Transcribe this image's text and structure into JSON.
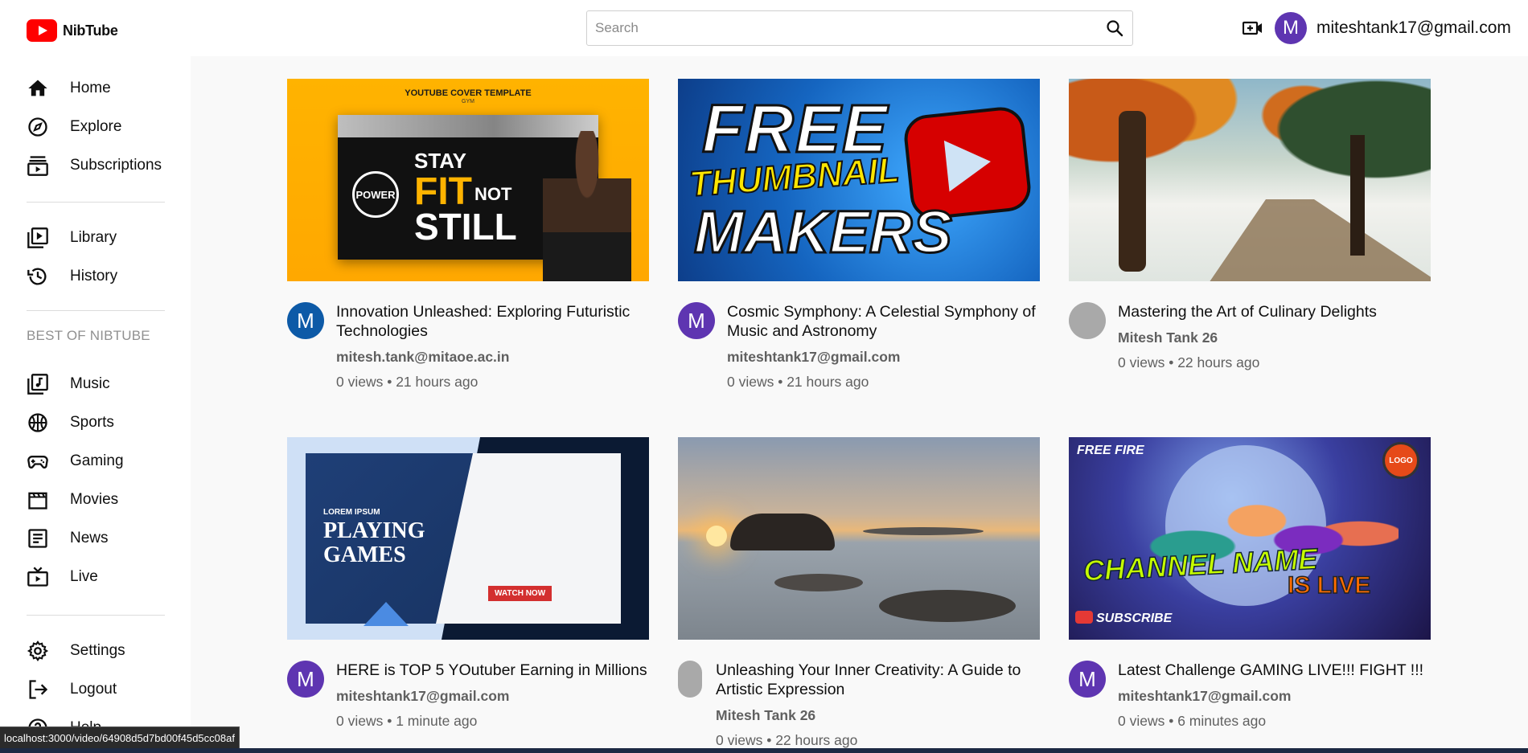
{
  "app": {
    "name": "NibTube"
  },
  "header": {
    "search_placeholder": "Search",
    "user_initial": "M",
    "user_email": "miteshtank17@gmail.com"
  },
  "sidebar": {
    "primary": [
      {
        "label": "Home",
        "icon": "home-icon"
      },
      {
        "label": "Explore",
        "icon": "compass-icon"
      },
      {
        "label": "Subscriptions",
        "icon": "subscriptions-icon"
      }
    ],
    "secondary": [
      {
        "label": "Library",
        "icon": "library-icon"
      },
      {
        "label": "History",
        "icon": "history-icon"
      }
    ],
    "section_title": "BEST OF NIBTUBE",
    "best": [
      {
        "label": "Music",
        "icon": "music-icon"
      },
      {
        "label": "Sports",
        "icon": "sports-icon"
      },
      {
        "label": "Gaming",
        "icon": "gaming-icon"
      },
      {
        "label": "Movies",
        "icon": "movies-icon"
      },
      {
        "label": "News",
        "icon": "news-icon"
      },
      {
        "label": "Live",
        "icon": "live-icon"
      }
    ],
    "footer": [
      {
        "label": "Settings",
        "icon": "settings-icon"
      },
      {
        "label": "Logout",
        "icon": "logout-icon"
      },
      {
        "label": "Help",
        "icon": "help-icon"
      }
    ]
  },
  "videos": [
    {
      "title": "Innovation Unleashed: Exploring Futuristic Technologies",
      "channel": "mitesh.tank@mitaoe.ac.in",
      "stats": "0 views • 21 hours ago",
      "avatar_initial": "M",
      "thumb_text": {
        "caption": "YOUTUBE COVER TEMPLATE",
        "caption2": "GYM",
        "seal": "POWER",
        "stay": "STAY",
        "fit": "FIT",
        "not": "NOT",
        "still": "STILL"
      }
    },
    {
      "title": "Cosmic Symphony: A Celestial Symphony of Music and Astronomy",
      "channel": "miteshtank17@gmail.com",
      "stats": "0 views • 21 hours ago",
      "avatar_initial": "M",
      "thumb_text": {
        "w1": "FREE",
        "w2": "THUMBNAIL",
        "w3": "MAKERS"
      }
    },
    {
      "title": "Mastering the Art of Culinary Delights",
      "channel": "Mitesh Tank 26",
      "stats": "0 views • 22 hours ago",
      "avatar_initial": ""
    },
    {
      "title": "HERE is TOP 5 YOutuber Earning in Millions",
      "channel": "miteshtank17@gmail.com",
      "stats": "0 views • 1 minute ago",
      "avatar_initial": "M",
      "thumb_text": {
        "lorem": "LOREM IPSUM",
        "play": "PLAYING",
        "games": "GAMES",
        "watch": "WATCH NOW"
      }
    },
    {
      "title": "Unleashing Your Inner Creativity: A Guide to Artistic Expression",
      "channel": "Mitesh Tank 26",
      "stats": "0 views • 22 hours ago",
      "avatar_initial": ""
    },
    {
      "title": "Latest Challenge GAMING LIVE!!! FIGHT !!!",
      "channel": "miteshtank17@gmail.com",
      "stats": "0 views • 6 minutes ago",
      "avatar_initial": "M",
      "thumb_text": {
        "ff": "FREE FIRE",
        "logo": "LOGO",
        "cname": "CHANNEL NAME",
        "live": "IS LIVE",
        "sub": "SUBSCRIBE"
      }
    }
  ],
  "statusbar": {
    "url": "localhost:3000/video/64908d5d7bd00f45d5cc08af"
  },
  "colors": {
    "brand_red": "#ff0000",
    "avatar_purple": "#5e35b1",
    "avatar_blue": "#0d5aa7",
    "avatar_grey": "#a9a9a9",
    "secondary_text": "#606060"
  }
}
